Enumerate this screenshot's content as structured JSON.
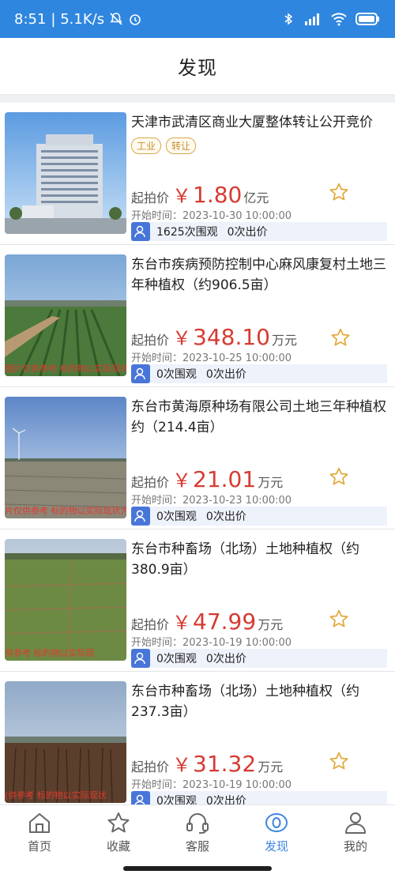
{
  "status_bar": {
    "time": "8:51",
    "speed": "| 5.1K/s"
  },
  "header": {
    "title": "发现"
  },
  "items": [
    {
      "title": "天津市武清区商业大厦整体转让公开竞价",
      "tags": [
        "工业",
        "转让"
      ],
      "price_label": "起拍价",
      "currency": "￥",
      "price": "1.80",
      "unit": "亿元",
      "start_time": "开始时间：2023-10-30 10:00:00",
      "views": "1625次围观",
      "bids": "0次出价",
      "watermark": ""
    },
    {
      "title": "东台市疾病预防控制中心麻风康复村土地三年种植权（约906.5亩）",
      "tags": [],
      "price_label": "起拍价",
      "currency": "￥",
      "price": "348.10",
      "unit": "万元",
      "start_time": "开始时间：2023-10-25 10:00:00",
      "views": "0次围观",
      "bids": "0次出价",
      "watermark": "图片仅供参考 标的物以实际现状为准"
    },
    {
      "title": "东台市黄海原种场有限公司土地三年种植权约（214.4亩）",
      "tags": [],
      "price_label": "起拍价",
      "currency": "￥",
      "price": "21.01",
      "unit": "万元",
      "start_time": "开始时间：2023-10-23 10:00:00",
      "views": "0次围观",
      "bids": "0次出价",
      "watermark": "片仅供参考 标的物以实际现状为"
    },
    {
      "title": "东台市种畜场（北场）土地种植权（约380.9亩）",
      "tags": [],
      "price_label": "起拍价",
      "currency": "￥",
      "price": "47.99",
      "unit": "万元",
      "start_time": "开始时间：2023-10-19 10:00:00",
      "views": "0次围观",
      "bids": "0次出价",
      "watermark": "供参考 标的物以实际现"
    },
    {
      "title": "东台市种畜场（北场）土地种植权（约237.3亩）",
      "tags": [],
      "price_label": "起拍价",
      "currency": "￥",
      "price": "31.32",
      "unit": "万元",
      "start_time": "开始时间：2023-10-19 10:00:00",
      "views": "0次围观",
      "bids": "0次出价",
      "watermark": "(供参考 标的物以实际现状"
    }
  ],
  "tabs": [
    {
      "label": "首页",
      "icon": "home-icon"
    },
    {
      "label": "收藏",
      "icon": "star-icon"
    },
    {
      "label": "客服",
      "icon": "headset-icon"
    },
    {
      "label": "发现",
      "icon": "discover-icon"
    },
    {
      "label": "我的",
      "icon": "user-icon"
    }
  ],
  "colors": {
    "status_bar": "#2f86df",
    "accent": "#3c86df",
    "price": "#d63b32",
    "tag": "#c7902a"
  }
}
